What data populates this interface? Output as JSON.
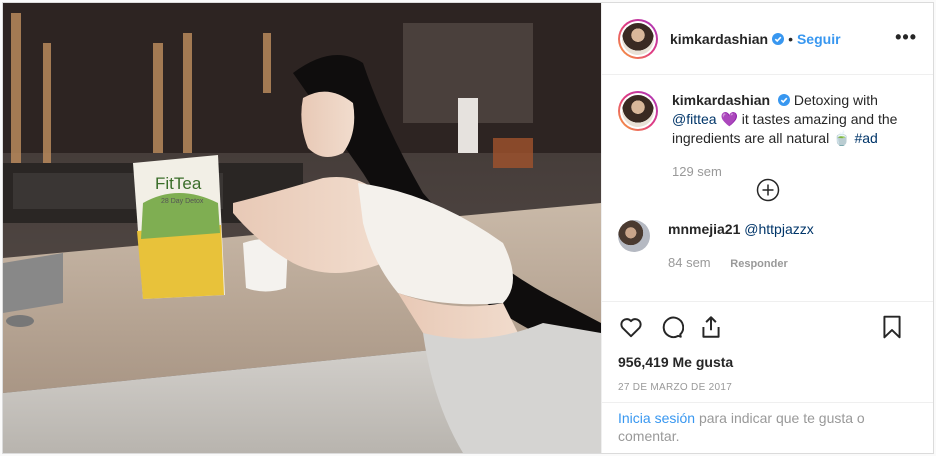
{
  "header": {
    "username": "kimkardashian",
    "separator": "•",
    "follow_label": "Seguir",
    "more_label": "•••"
  },
  "caption": {
    "username": "kimkardashian",
    "text_before": "Detoxing with",
    "mention": "@fittea",
    "emoji_heart": "💜",
    "text_after": "it tastes amazing and the ingredients are all natural",
    "emoji_tea": "🍵",
    "hashtag": "#ad",
    "time": "129 sem"
  },
  "comment": {
    "username": "mnmejia21",
    "mention": "@httpjazzx",
    "time": "84 sem",
    "reply_label": "Responder"
  },
  "actions": {
    "likes": "956,419 Me gusta",
    "date": "27 de marzo de 2017"
  },
  "login": {
    "link": "Inicia sesión",
    "rest": "para indicar que te gusta o comentar."
  },
  "photo": {
    "package_brand": "FitTea",
    "package_sub": "28 Day Detox"
  },
  "colors": {
    "accent": "#3897f0",
    "verified": "#3897f0",
    "heart_emoji": "#8e44c8"
  }
}
